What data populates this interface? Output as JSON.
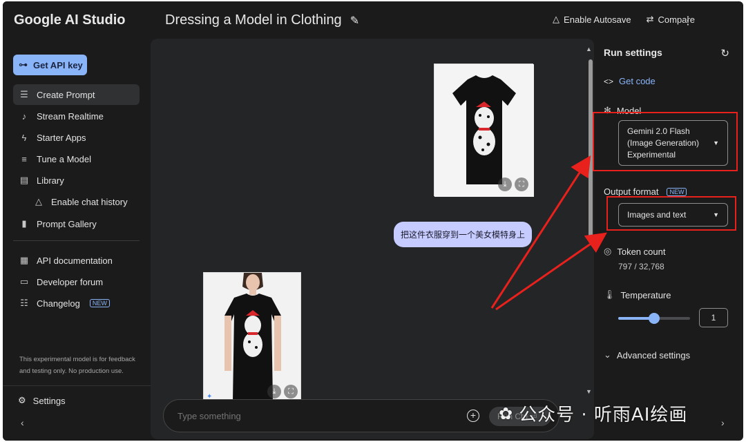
{
  "brand": "Google AI Studio",
  "header": {
    "title": "Dressing a Model in Clothing",
    "autosave_label": "Enable Autosave",
    "compare_label": "Compare"
  },
  "sidebar": {
    "api_key_label": "Get API key",
    "items": [
      {
        "label": "Create Prompt",
        "icon": "create-prompt-icon"
      },
      {
        "label": "Stream Realtime",
        "icon": "microphone-icon"
      },
      {
        "label": "Starter Apps",
        "icon": "bolt-icon"
      },
      {
        "label": "Tune a Model",
        "icon": "tune-icon"
      },
      {
        "label": "Library",
        "icon": "library-icon"
      },
      {
        "label": "Enable chat history",
        "icon": "history-icon"
      },
      {
        "label": "Prompt Gallery",
        "icon": "book-icon"
      },
      {
        "label": "API documentation",
        "icon": "doc-icon"
      },
      {
        "label": "Developer forum",
        "icon": "forum-icon"
      },
      {
        "label": "Changelog",
        "icon": "changelog-icon",
        "badge": "NEW"
      }
    ],
    "footnote": "This experimental model is for feedback and testing only. No production use.",
    "settings_label": "Settings"
  },
  "chat": {
    "user_message": "把这件衣服穿到一个美女模特身上",
    "input_placeholder": "Type something",
    "run_label": "Run Ctrl ⏎"
  },
  "run_settings": {
    "title": "Run settings",
    "get_code_label": "Get code",
    "model_label": "Model",
    "model_value": "Gemini 2.0 Flash (Image Generation) Experimental",
    "model_lines": [
      "Gemini 2.0 Flash",
      "(Image Generation)",
      "Experimental"
    ],
    "output_format_label": "Output format",
    "output_format_badge": "NEW",
    "output_format_value": "Images and text",
    "token_count_label": "Token count",
    "token_count_value": "797 / 32,768",
    "temperature_label": "Temperature",
    "temperature_value": "1",
    "temperature_fraction": 0.5,
    "advanced_label": "Advanced settings"
  },
  "watermark": "公众号 · 听雨AI绘画",
  "colors": {
    "accent": "#8ab4f8",
    "annotation_red": "#e8211d",
    "bubble": "#c6ccff"
  }
}
